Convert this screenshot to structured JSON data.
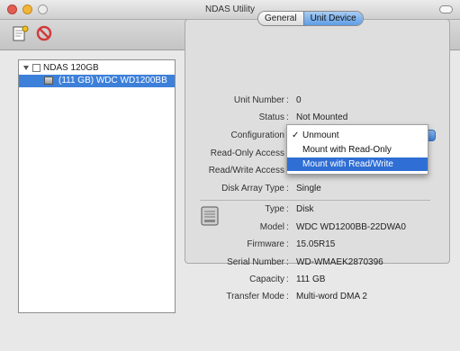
{
  "window": {
    "title": "NDAS Utility"
  },
  "toolbar": {
    "items": [
      {
        "icon": "register-device-icon"
      },
      {
        "icon": "unregister-icon"
      }
    ]
  },
  "tree": {
    "root": {
      "label": "NDAS 120GB",
      "checked": false,
      "expanded": true
    },
    "child": {
      "label": "(111 GB) WDC WD1200BB",
      "selected": true
    }
  },
  "tabs": [
    {
      "label": "General",
      "active": false
    },
    {
      "label": "Unit Device",
      "active": true
    }
  ],
  "properties": [
    {
      "label": "Unit Number",
      "value": "0"
    },
    {
      "label": "Status",
      "value": "Not Mounted"
    },
    {
      "label": "Configuration",
      "value": "Unmount"
    },
    {
      "label": "Read-Only Access",
      "value": ""
    },
    {
      "label": "Read/Write Access",
      "value": ""
    },
    {
      "label": "Disk Array Type",
      "value": "Single"
    }
  ],
  "details": [
    {
      "label": "Type",
      "value": "Disk"
    },
    {
      "label": "Model",
      "value": "WDC WD1200BB-22DWA0"
    },
    {
      "label": "Firmware",
      "value": "15.05R15"
    },
    {
      "label": "Serial Number",
      "value": "WD-WMAEK2870396"
    },
    {
      "label": "Capacity",
      "value": "111 GB"
    },
    {
      "label": "Transfer Mode",
      "value": "Multi-word DMA 2"
    }
  ],
  "configuration_menu": {
    "items": [
      {
        "label": "Unmount",
        "checked": true,
        "highlighted": false
      },
      {
        "label": "Mount with Read-Only",
        "checked": false,
        "highlighted": false
      },
      {
        "label": "Mount with Read/Write",
        "checked": false,
        "highlighted": true
      }
    ],
    "check_mark": "✓"
  },
  "colors": {
    "selection": "#3d80d9",
    "menu_highlight": "#2f6ed4"
  }
}
